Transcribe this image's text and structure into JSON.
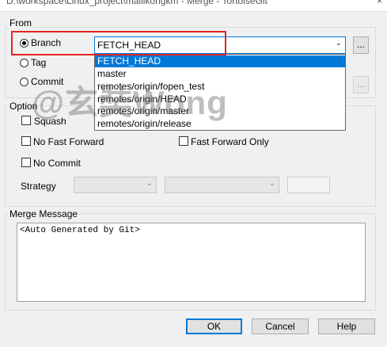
{
  "window": {
    "title": "D:\\workspace\\Linux_project\\mallikongkm - Merge - TortoiseGit",
    "close_glyph": "×"
  },
  "from": {
    "legend": "From",
    "branch_label": "Branch",
    "tag_label": "Tag",
    "commit_label": "Commit",
    "selected": "Branch",
    "branch_value": "FETCH_HEAD",
    "browse_label": "...",
    "branch_options": [
      "FETCH_HEAD",
      "master",
      "remotes/origin/fopen_test",
      "remotes/origin/HEAD",
      "remotes/origin/master",
      "remotes/origin/release"
    ],
    "highlighted_option": "FETCH_HEAD"
  },
  "option": {
    "legend": "Option",
    "squash_label": "Squash",
    "no_fast_forward_label": "No Fast Forward",
    "fast_forward_only_label": "Fast Forward Only",
    "no_commit_label": "No Commit",
    "strategy_label": "Strategy",
    "squash_checked": false,
    "no_fast_forward_checked": false,
    "fast_forward_only_checked": false,
    "no_commit_checked": false
  },
  "merge_message": {
    "legend": "Merge Message",
    "text": "<Auto Generated by Git>"
  },
  "buttons": {
    "ok": "OK",
    "cancel": "Cancel",
    "help": "Help"
  },
  "watermark": "@玄奘Wong",
  "colors": {
    "highlight": "#0078d7",
    "annotation_box": "#e32424"
  }
}
